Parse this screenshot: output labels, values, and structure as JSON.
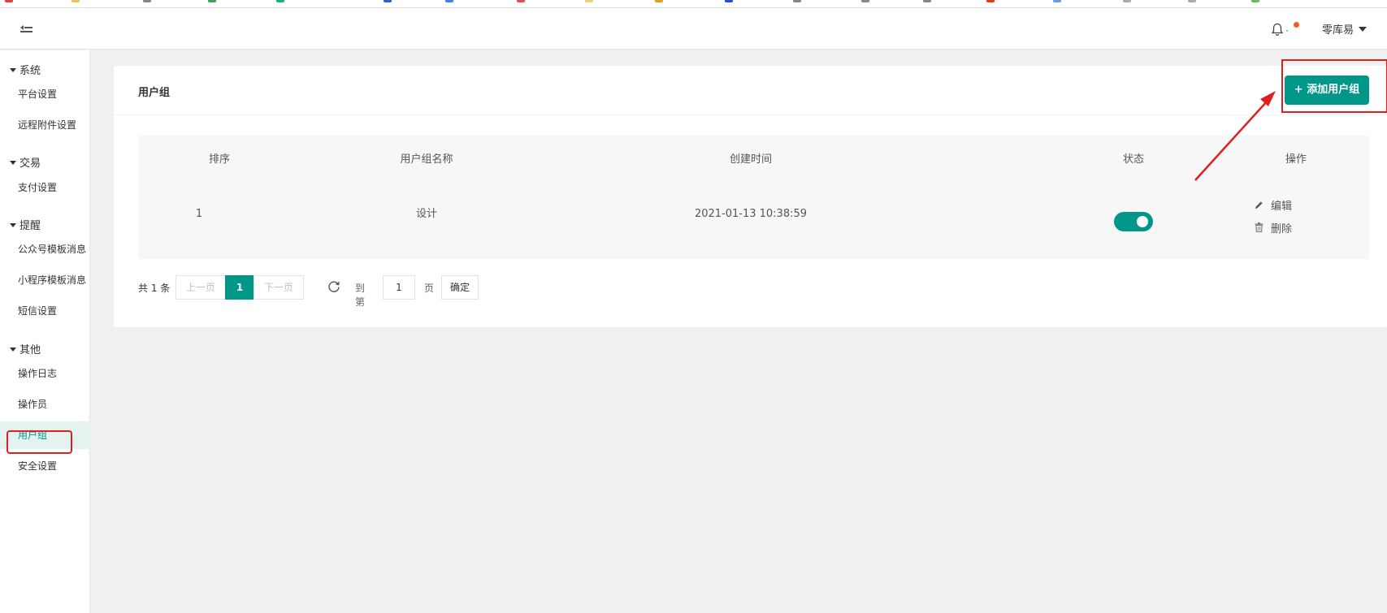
{
  "header": {
    "user_name": "零库易"
  },
  "sidebar": {
    "groups": [
      {
        "label": "系统",
        "items": [
          "平台设置",
          "远程附件设置"
        ]
      },
      {
        "label": "交易",
        "items": [
          "支付设置"
        ]
      },
      {
        "label": "提醒",
        "items": [
          "公众号模板消息",
          "小程序模板消息",
          "短信设置"
        ]
      },
      {
        "label": "其他",
        "items": [
          "操作日志",
          "操作员",
          "用户组",
          "安全设置"
        ]
      }
    ],
    "active_item": "用户组"
  },
  "main": {
    "title": "用户组",
    "add_button": "+ 添加用户组",
    "table": {
      "columns": [
        "排序",
        "用户组名称",
        "创建时间",
        "状态",
        "操作"
      ],
      "rows": [
        {
          "order": "1",
          "name": "设计",
          "created": "2021-01-13 10:38:59",
          "status_on": true,
          "edit": "编辑",
          "delete": "删除"
        }
      ]
    },
    "pagination": {
      "total": "共 1 条",
      "prev": "上一页",
      "current": "1",
      "next": "下一页",
      "goto_label": "到第",
      "goto_value": "1",
      "page_unit": "页",
      "confirm": "确定"
    }
  },
  "colors": {
    "accent": "#009688",
    "annotation": "#e02020",
    "notification_dot": "#ff5722"
  },
  "icons": [
    "menu-collapse-icon",
    "bell-icon",
    "chevron-down-icon",
    "refresh-icon",
    "edit-pencil-icon",
    "trash-icon"
  ]
}
